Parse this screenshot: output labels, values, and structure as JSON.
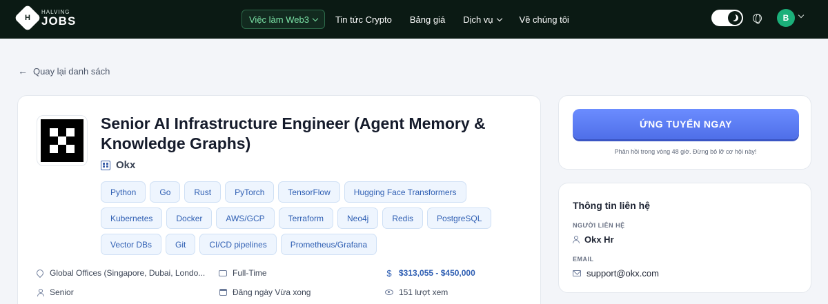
{
  "nav": {
    "logo_small": "HALVING",
    "logo_big": "JOBS",
    "logo_mark": "H",
    "menu": [
      {
        "label": "Việc làm Web3",
        "dropdown": true,
        "active": true
      },
      {
        "label": "Tin tức Crypto",
        "dropdown": false
      },
      {
        "label": "Bảng giá",
        "dropdown": false
      },
      {
        "label": "Dịch vụ",
        "dropdown": true
      },
      {
        "label": "Về chúng tôi",
        "dropdown": false
      }
    ],
    "avatar_initial": "B"
  },
  "back_link": "Quay lại danh sách",
  "job": {
    "title": "Senior AI Infrastructure Engineer (Agent Memory & Knowledge Graphs)",
    "company": "Okx",
    "tags": [
      "Python",
      "Go",
      "Rust",
      "PyTorch",
      "TensorFlow",
      "Hugging Face Transformers",
      "Kubernetes",
      "Docker",
      "AWS/GCP",
      "Terraform",
      "Neo4j",
      "Redis",
      "PostgreSQL",
      "Vector DBs",
      "Git",
      "CI/CD pipelines",
      "Prometheus/Grafana"
    ],
    "location": "Global Offices (Singapore, Dubai, Londo...",
    "job_type": "Full-Time",
    "salary": "$313,055 - $450,000",
    "level": "Senior",
    "posted": "Đăng ngày Vừa xong",
    "views": "151 lượt xem"
  },
  "apply": {
    "button_label": "ỨNG TUYỂN NGAY",
    "note": "Phản hồi trong vòng 48 giờ. Đừng bỏ lỡ cơ hội này!"
  },
  "contact": {
    "title": "Thông tin liên hệ",
    "person_label": "NGƯỜI LIÊN HỆ",
    "person_value": "Okx Hr",
    "email_label": "EMAIL",
    "email_value": "support@okx.com"
  }
}
